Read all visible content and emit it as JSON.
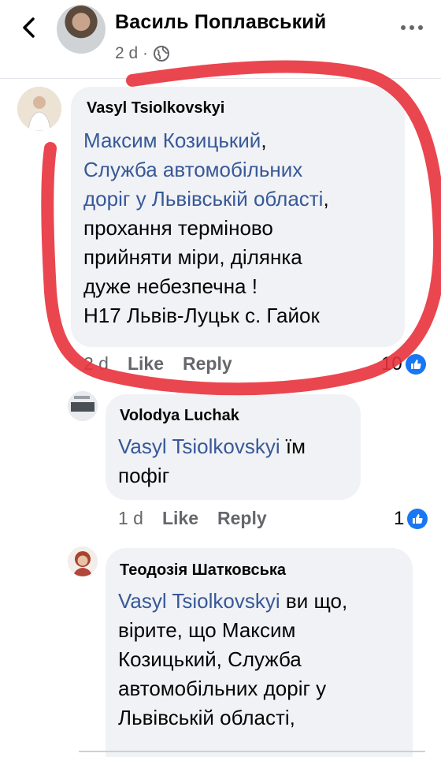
{
  "header": {
    "back_icon": "chevron-left-icon",
    "title": "Василь Поплавський",
    "time": "2 d ·",
    "privacy_icon": "globe-icon",
    "more_icon": "more-horizontal-icon"
  },
  "comments": [
    {
      "author": "Vasyl Tsiolkovskyi",
      "lines": [
        {
          "mention": "Максим Козицький",
          "rest": ","
        },
        {
          "mention": "Служба автомобільних",
          "rest": ""
        },
        {
          "mention": "доріг у Львівській області",
          "rest": ","
        },
        {
          "mention": "",
          "rest": "прохання терміново"
        },
        {
          "mention": "",
          "rest": "прийняти міри,  ділянка"
        },
        {
          "mention": "",
          "rest": "дуже небезпечна !"
        },
        {
          "mention": "",
          "rest": "Н17 Львів-Луцьк  с. Гайок"
        }
      ],
      "time": "2 d",
      "like": "Like",
      "reply": "Reply",
      "reactions": "10"
    },
    {
      "author": "Volodya  Luchak",
      "lines": [
        {
          "mention": "Vasyl Tsiolkovskyi",
          "rest": " їм"
        },
        {
          "mention": "",
          "rest": "пофіг"
        }
      ],
      "time": "1 d",
      "like": "Like",
      "reply": "Reply",
      "reactions": "1"
    },
    {
      "author": "Теодозія Шатковська",
      "lines": [
        {
          "mention": "Vasyl Tsiolkovskyi",
          "rest": " ви що,"
        },
        {
          "mention": "",
          "rest": "вірите, що Максим"
        },
        {
          "mention": "",
          "rest": "Козицький, Служба"
        },
        {
          "mention": "",
          "rest": "автомобільних доріг у"
        },
        {
          "mention": "",
          "rest": "Львівській області,"
        }
      ]
    }
  ],
  "colors": {
    "mention": "#385898",
    "bubble": "#f0f2f5",
    "muted": "#65676b",
    "like_badge": "#1877f2",
    "highlight": "#e8323c"
  }
}
